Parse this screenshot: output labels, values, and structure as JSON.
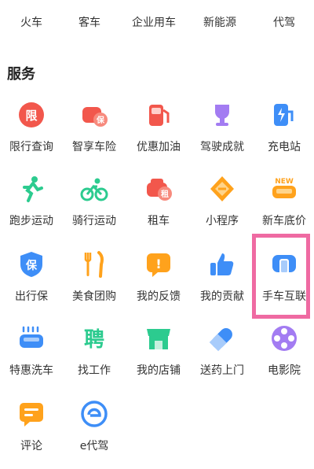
{
  "top_row": [
    "火车",
    "客车",
    "企业用车",
    "新能源",
    "代驾"
  ],
  "section": {
    "title": "服务"
  },
  "services": [
    {
      "label": "限行查询",
      "icon": "restriction-icon",
      "glyph": "限"
    },
    {
      "label": "智享车险",
      "icon": "car-insurance-icon",
      "glyph": "保"
    },
    {
      "label": "优惠加油",
      "icon": "fuel-pump-icon",
      "glyph": ""
    },
    {
      "label": "驾驶成就",
      "icon": "trophy-icon",
      "glyph": ""
    },
    {
      "label": "充电站",
      "icon": "charging-station-icon",
      "glyph": ""
    },
    {
      "label": "跑步运动",
      "icon": "running-icon",
      "glyph": ""
    },
    {
      "label": "骑行运动",
      "icon": "cycling-icon",
      "glyph": ""
    },
    {
      "label": "租车",
      "icon": "car-rental-icon",
      "glyph": "租"
    },
    {
      "label": "小程序",
      "icon": "mini-program-icon",
      "glyph": ""
    },
    {
      "label": "新车底价",
      "icon": "new-car-icon",
      "glyph": "NEW"
    },
    {
      "label": "出行保",
      "icon": "travel-insurance-icon",
      "glyph": "保"
    },
    {
      "label": "美食团购",
      "icon": "food-icon",
      "glyph": ""
    },
    {
      "label": "我的反馈",
      "icon": "feedback-icon",
      "glyph": "!"
    },
    {
      "label": "我的贡献",
      "icon": "thumbs-up-icon",
      "glyph": ""
    },
    {
      "label": "手车互联",
      "icon": "phone-car-link-icon",
      "glyph": ""
    },
    {
      "label": "特惠洗车",
      "icon": "car-wash-icon",
      "glyph": ""
    },
    {
      "label": "找工作",
      "icon": "job-icon",
      "glyph": "聘"
    },
    {
      "label": "我的店铺",
      "icon": "shop-icon",
      "glyph": ""
    },
    {
      "label": "送药上门",
      "icon": "medicine-icon",
      "glyph": ""
    },
    {
      "label": "电影院",
      "icon": "cinema-icon",
      "glyph": ""
    },
    {
      "label": "评论",
      "icon": "comment-icon",
      "glyph": ""
    },
    {
      "label": "e代驾",
      "icon": "e-driver-icon",
      "glyph": ""
    }
  ],
  "colors": {
    "red": "#f2574c",
    "orange": "#ffa21c",
    "blue": "#3e8ef7",
    "green": "#2ccb8f",
    "purple": "#a37cf2",
    "highlight": "#ef6aa2"
  }
}
